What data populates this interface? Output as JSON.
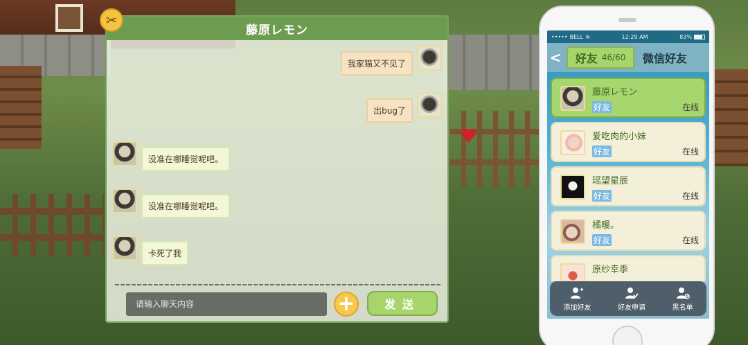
{
  "chat": {
    "title": "藤原レモン",
    "messages": [
      {
        "side": "right",
        "text": "我家猫又不见了"
      },
      {
        "side": "right",
        "text": "出bug了"
      },
      {
        "side": "left",
        "text": "没准在哪睡觉呢吧。"
      },
      {
        "side": "left",
        "text": "没准在哪睡觉呢吧。"
      },
      {
        "side": "left",
        "text": "卡死了我"
      }
    ],
    "input_placeholder": "请输入聊天内容",
    "plus_label": "+",
    "send_label": "发送"
  },
  "phone": {
    "status": {
      "carrier": "BELL",
      "time": "12:29 AM",
      "battery": "83%"
    },
    "tabs": {
      "friends_label": "好友",
      "friends_count": "46/60",
      "wechat_label": "微信好友"
    },
    "friends": [
      {
        "name": "藤原レモン",
        "tag": "好友",
        "status": "在线",
        "selected": true
      },
      {
        "name": "爱吃肉的小妹",
        "tag": "好友",
        "status": "在线",
        "selected": false
      },
      {
        "name": "瑶望星辰",
        "tag": "好友",
        "status": "在线",
        "selected": false
      },
      {
        "name": "橘暖。",
        "tag": "好友",
        "status": "在线",
        "selected": false
      },
      {
        "name": "原纱幸季",
        "tag": "",
        "status": "",
        "selected": false
      }
    ],
    "bottom_bar": [
      {
        "label": "添加好友",
        "icon": "add-user-icon"
      },
      {
        "label": "好友申请",
        "icon": "user-check-icon"
      },
      {
        "label": "黑名单",
        "icon": "user-block-icon"
      }
    ]
  },
  "colors": {
    "accent_green": "#a7d56c",
    "header_green": "#6c9c50",
    "phone_blue": "#4eb0d2",
    "plus_yellow": "#f6c84c"
  }
}
